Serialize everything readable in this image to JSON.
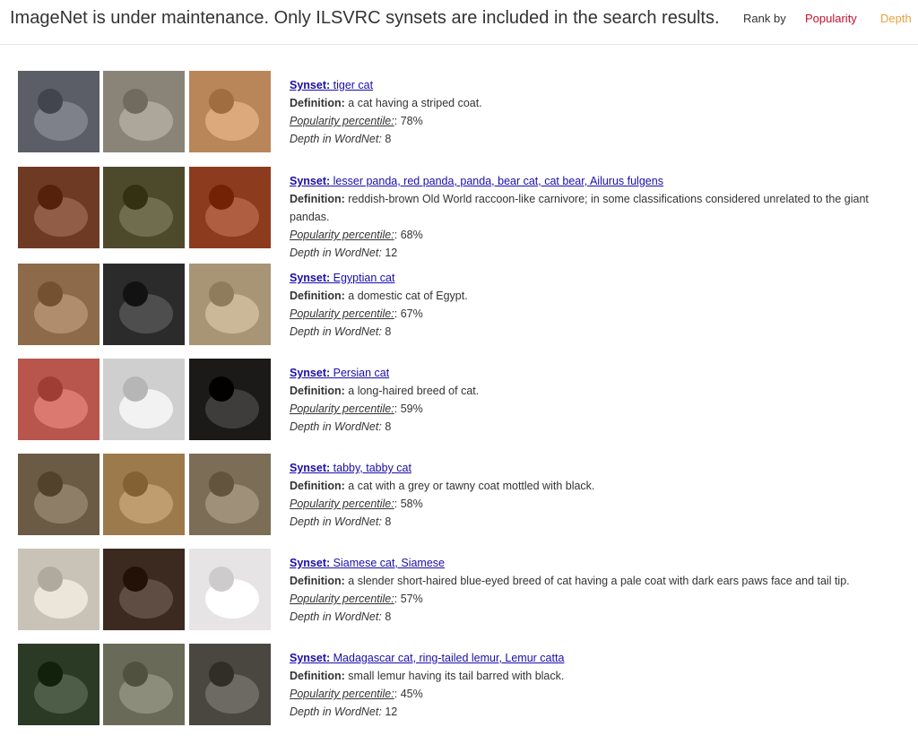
{
  "header": {
    "notice": "ImageNet is under maintenance. Only ILSVRC synsets are included in the search results.",
    "rank_by_label": "Rank by",
    "rank_popularity": "Popularity",
    "rank_depth": "Depth"
  },
  "labels": {
    "synset": "Synset:",
    "definition": "Definition:",
    "popularity": "Popularity percentile:",
    "depth": "Depth in WordNet:"
  },
  "colors": {
    "link": "#1a0dab",
    "popularity": "#c8102e",
    "depth": "#e8a33d"
  },
  "results": [
    {
      "name": "tiger cat",
      "definition": "a cat having a striped coat.",
      "popularity": "78%",
      "depth": "8",
      "thumbs": [
        "#5b5e66",
        "#8a8478",
        "#b9865a"
      ]
    },
    {
      "name": "lesser panda, red panda, panda, bear cat, cat bear, Ailurus fulgens",
      "definition": "reddish-brown Old World raccoon-like carnivore; in some classifications considered unrelated to the giant pandas.",
      "popularity": "68%",
      "depth": "12",
      "thumbs": [
        "#6e3a24",
        "#4d4a2c",
        "#8c3b1e"
      ]
    },
    {
      "name": "Egyptian cat",
      "definition": "a domestic cat of Egypt.",
      "popularity": "67%",
      "depth": "8",
      "thumbs": [
        "#8d6a4a",
        "#2b2b2b",
        "#a89576"
      ]
    },
    {
      "name": "Persian cat",
      "definition": "a long-haired breed of cat.",
      "popularity": "59%",
      "depth": "8",
      "thumbs": [
        "#b8554d",
        "#cfcfcf",
        "#1c1a18"
      ]
    },
    {
      "name": "tabby, tabby cat",
      "definition": "a cat with a grey or tawny coat mottled with black.",
      "popularity": "58%",
      "depth": "8",
      "thumbs": [
        "#6b5a44",
        "#9c7a4c",
        "#7b6d56"
      ]
    },
    {
      "name": "Siamese cat, Siamese",
      "definition": "a slender short-haired blue-eyed breed of cat having a pale coat with dark ears paws face and tail tip.",
      "popularity": "57%",
      "depth": "8",
      "thumbs": [
        "#c9c2b6",
        "#3c2a20",
        "#e6e4e4"
      ]
    },
    {
      "name": "Madagascar cat, ring-tailed lemur, Lemur catta",
      "definition": "small lemur having its tail barred with black.",
      "popularity": "45%",
      "depth": "12",
      "thumbs": [
        "#2a3a25",
        "#6a6a58",
        "#4a4640"
      ]
    }
  ]
}
